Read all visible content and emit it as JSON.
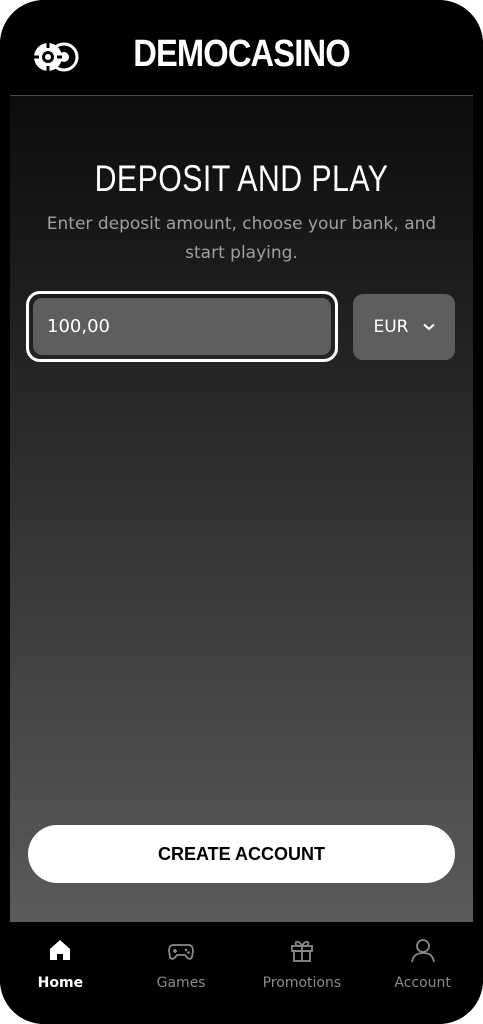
{
  "header": {
    "brand": "DEMOCASINO",
    "logo_icon": "casino-chips-icon"
  },
  "main": {
    "title": "DEPOSIT AND PLAY",
    "subtitle": "Enter deposit amount, choose your bank, and start playing.",
    "amount_value": "100,00",
    "currency": "EUR",
    "cta_label": "CREATE ACCOUNT"
  },
  "nav": {
    "items": [
      {
        "label": "Home",
        "icon": "home-icon",
        "active": true
      },
      {
        "label": "Games",
        "icon": "gamepad-icon",
        "active": false
      },
      {
        "label": "Promotions",
        "icon": "gift-icon",
        "active": false
      },
      {
        "label": "Account",
        "icon": "user-icon",
        "active": false
      }
    ]
  },
  "colors": {
    "background": "#000000",
    "input_fill": "#5e5e5e",
    "active_nav": "#ffffff",
    "inactive_nav": "#8a8a8a"
  }
}
